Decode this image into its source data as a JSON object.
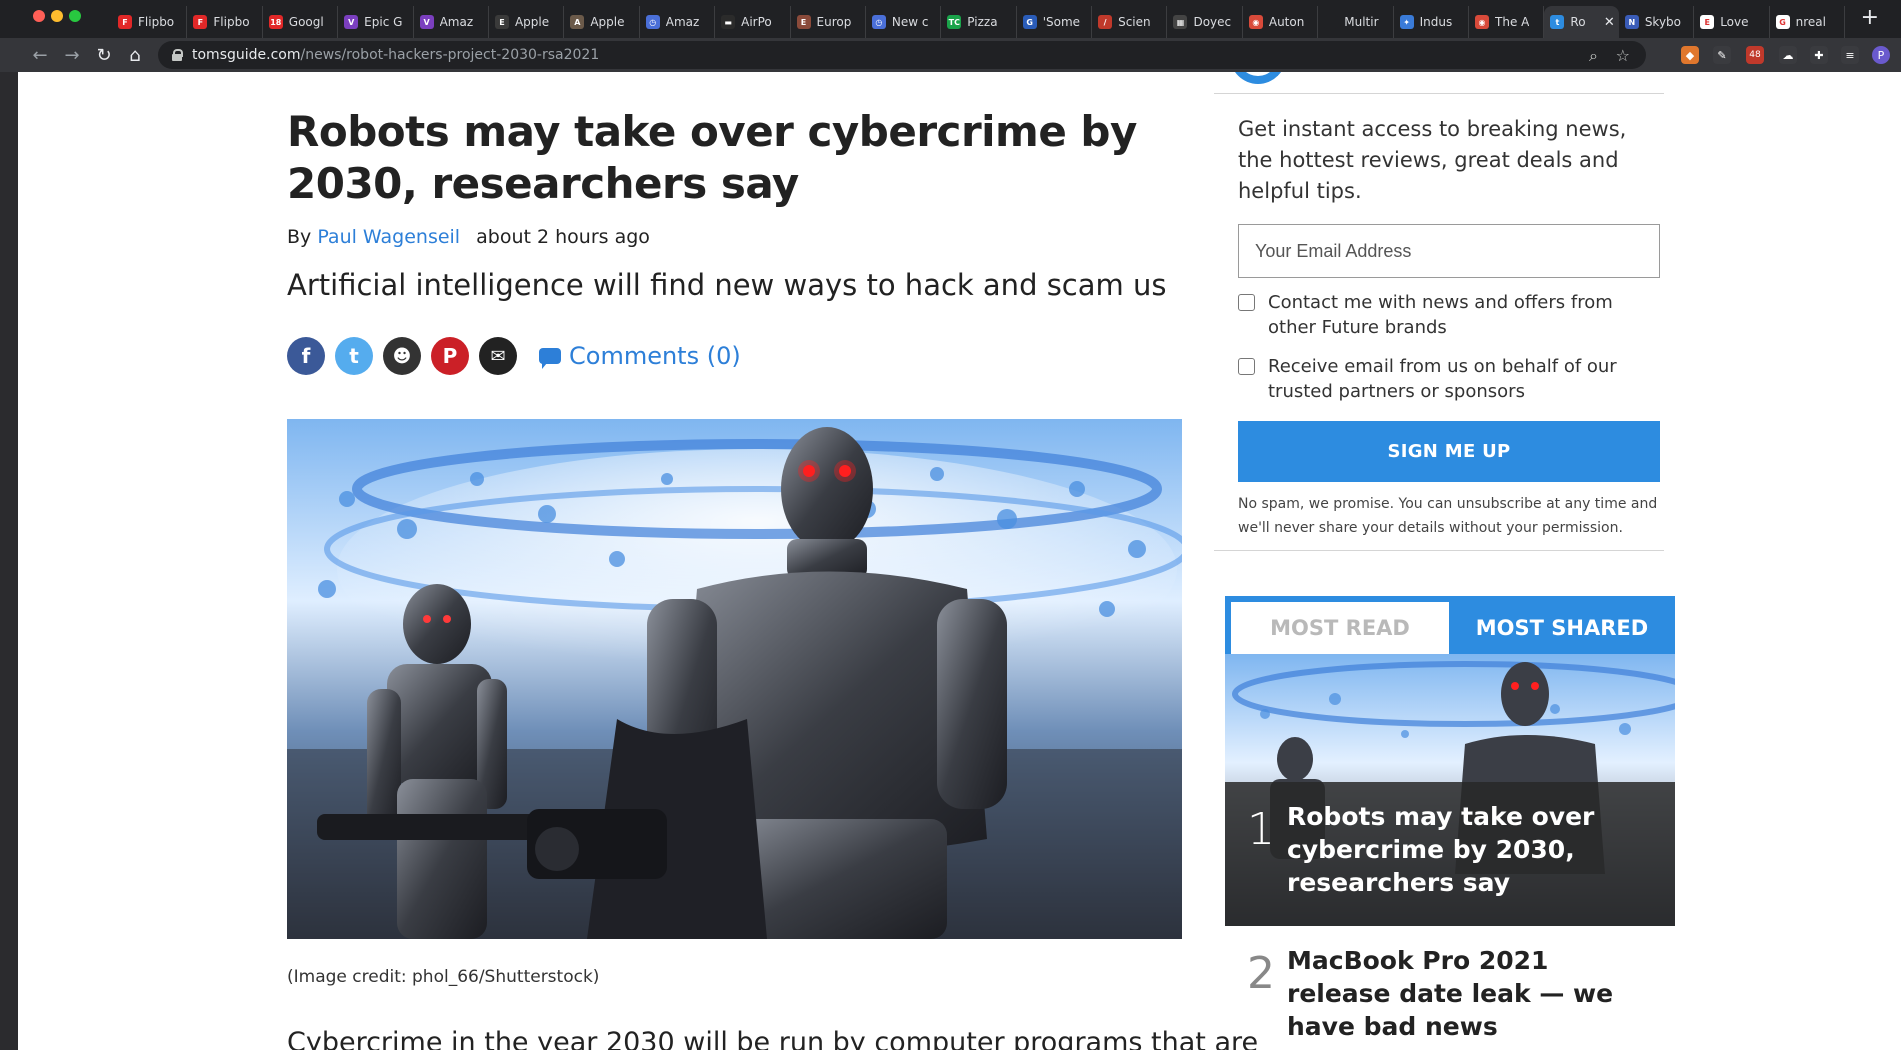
{
  "browser": {
    "tabs": [
      {
        "title": "Flipbo",
        "favicon_color": "#e12828",
        "favicon_text": "F"
      },
      {
        "title": "Flipbo",
        "favicon_color": "#e12828",
        "favicon_text": "F"
      },
      {
        "title": "Googl",
        "favicon_color": "#e12828",
        "favicon_text": "18"
      },
      {
        "title": "Epic G",
        "favicon_color": "#7b3fbf",
        "favicon_text": "V"
      },
      {
        "title": "Amaz",
        "favicon_color": "#7b3fbf",
        "favicon_text": "V"
      },
      {
        "title": "Apple",
        "favicon_color": "#3a3a3a",
        "favicon_text": "E"
      },
      {
        "title": "Apple",
        "favicon_color": "#6b5a4a",
        "favicon_text": "A"
      },
      {
        "title": "Amaz",
        "favicon_color": "#4a6fd8",
        "favicon_text": "◷"
      },
      {
        "title": "AirPo",
        "favicon_color": "#2b2b2b",
        "favicon_text": "▬"
      },
      {
        "title": "Europ",
        "favicon_color": "#8a4a3a",
        "favicon_text": "E"
      },
      {
        "title": "New c",
        "favicon_color": "#4a6fd8",
        "favicon_text": "◷"
      },
      {
        "title": "Pizza",
        "favicon_color": "#1aa34a",
        "favicon_text": "TC"
      },
      {
        "title": "'Some",
        "favicon_color": "#2a5cb8",
        "favicon_text": "G"
      },
      {
        "title": "Scien",
        "favicon_color": "#c0392b",
        "favicon_text": "/"
      },
      {
        "title": "Doyec",
        "favicon_color": "#444444",
        "favicon_text": "▦"
      },
      {
        "title": "Auton",
        "favicon_color": "#d84a3a",
        "favicon_text": "◉"
      },
      {
        "title": "Multir",
        "favicon_color": "#202124",
        "favicon_text": ""
      },
      {
        "title": "Indus",
        "favicon_color": "#3a7bd8",
        "favicon_text": "✦"
      },
      {
        "title": "The A",
        "favicon_color": "#d84a3a",
        "favicon_text": "◉"
      },
      {
        "title": "Ro",
        "favicon_color": "#2d8ce0",
        "favicon_text": "t",
        "active": true
      },
      {
        "title": "Skybo",
        "favicon_color": "#3a5cb8",
        "favicon_text": "N"
      },
      {
        "title": "Love",
        "favicon_color": "#ffffff",
        "favicon_text": "E"
      },
      {
        "title": "nreal",
        "favicon_color": "#ffffff",
        "favicon_text": "G"
      }
    ],
    "active_close": "✕",
    "new_tab": "+",
    "url_host": "tomsguide.com",
    "url_path": "/news/robot-hackers-project-2030-rsa2021",
    "extension_badge": "48"
  },
  "article": {
    "headline": "Robots may take over cybercrime by 2030, researchers say",
    "by_prefix": "By",
    "author": "Paul Wagenseil",
    "time": "about 2 hours ago",
    "strap": "Artificial intelligence will find new ways to hack and scam us",
    "share": [
      {
        "name": "facebook",
        "color": "#3b5998",
        "glyph": "f"
      },
      {
        "name": "twitter",
        "color": "#55acee",
        "glyph": "t"
      },
      {
        "name": "reddit",
        "color": "#333333",
        "glyph": "☻"
      },
      {
        "name": "pinterest",
        "color": "#cb2027",
        "glyph": "P"
      },
      {
        "name": "email",
        "color": "#222222",
        "glyph": "✉"
      }
    ],
    "comments": "Comments (0)",
    "image_credit": "(Image credit: phol_66/Shutterstock)",
    "body_peek": "Cybercrime in the year 2030 will be run by computer programs that are"
  },
  "sidebar": {
    "promo": "Get instant access to breaking news, the hottest reviews, great deals and helpful tips.",
    "email_placeholder": "Your Email Address",
    "checkbox1": "Contact me with news and offers from other Future brands",
    "checkbox2": "Receive email from us on behalf of our trusted partners or sponsors",
    "signup": "SIGN ME UP",
    "nospam": "No spam, we promise. You can unsubscribe at any time and we'll never share your details without your permission.",
    "tab_most_read": "MOST READ",
    "tab_most_shared": "MOST SHARED",
    "items": [
      {
        "rank": "1",
        "title": "Robots may take over cybercrime by 2030, researchers say"
      },
      {
        "rank": "2",
        "title": "MacBook Pro 2021 release date leak — we have bad news"
      }
    ]
  }
}
